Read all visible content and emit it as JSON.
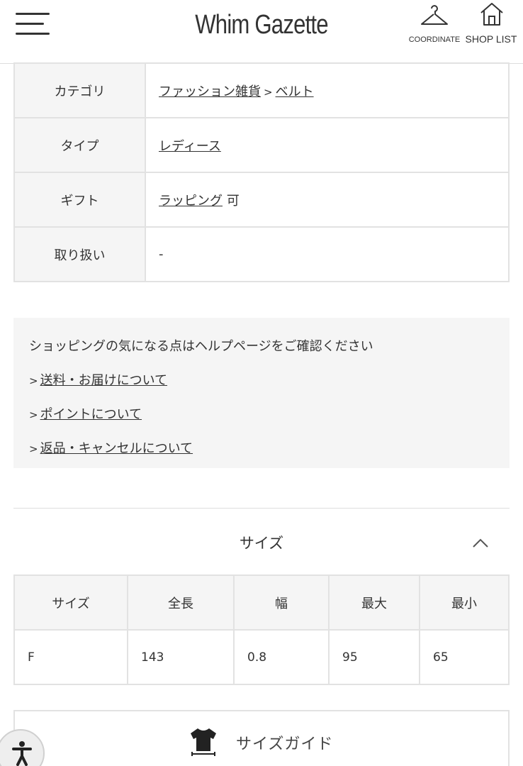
{
  "header": {
    "logo": "Whim Gazette",
    "coordinate_label": "COORDINATE",
    "shop_list_label": "SHOP LIST"
  },
  "spec": {
    "rows": [
      {
        "key": "カテゴリ",
        "links": [
          "ファッション雑貨",
          "ベルト"
        ],
        "separator": ">"
      },
      {
        "key": "タイプ",
        "link": "レディース"
      },
      {
        "key": "ギフト",
        "link": "ラッピング",
        "suffix": "可"
      },
      {
        "key": "取り扱い",
        "value": "-"
      }
    ]
  },
  "help": {
    "intro": "ショッピングの気になる点はヘルプページをご確認ください",
    "marker": ">",
    "links": [
      "送料・お届けについて",
      "ポイントについて",
      "返品・キャンセルについて"
    ]
  },
  "size": {
    "title": "サイズ",
    "headers": [
      "サイズ",
      "全長",
      "幅",
      "最大",
      "最小"
    ],
    "rows": [
      [
        "F",
        "143",
        "0.8",
        "95",
        "65"
      ]
    ],
    "guide_label": "サイズガイド"
  }
}
